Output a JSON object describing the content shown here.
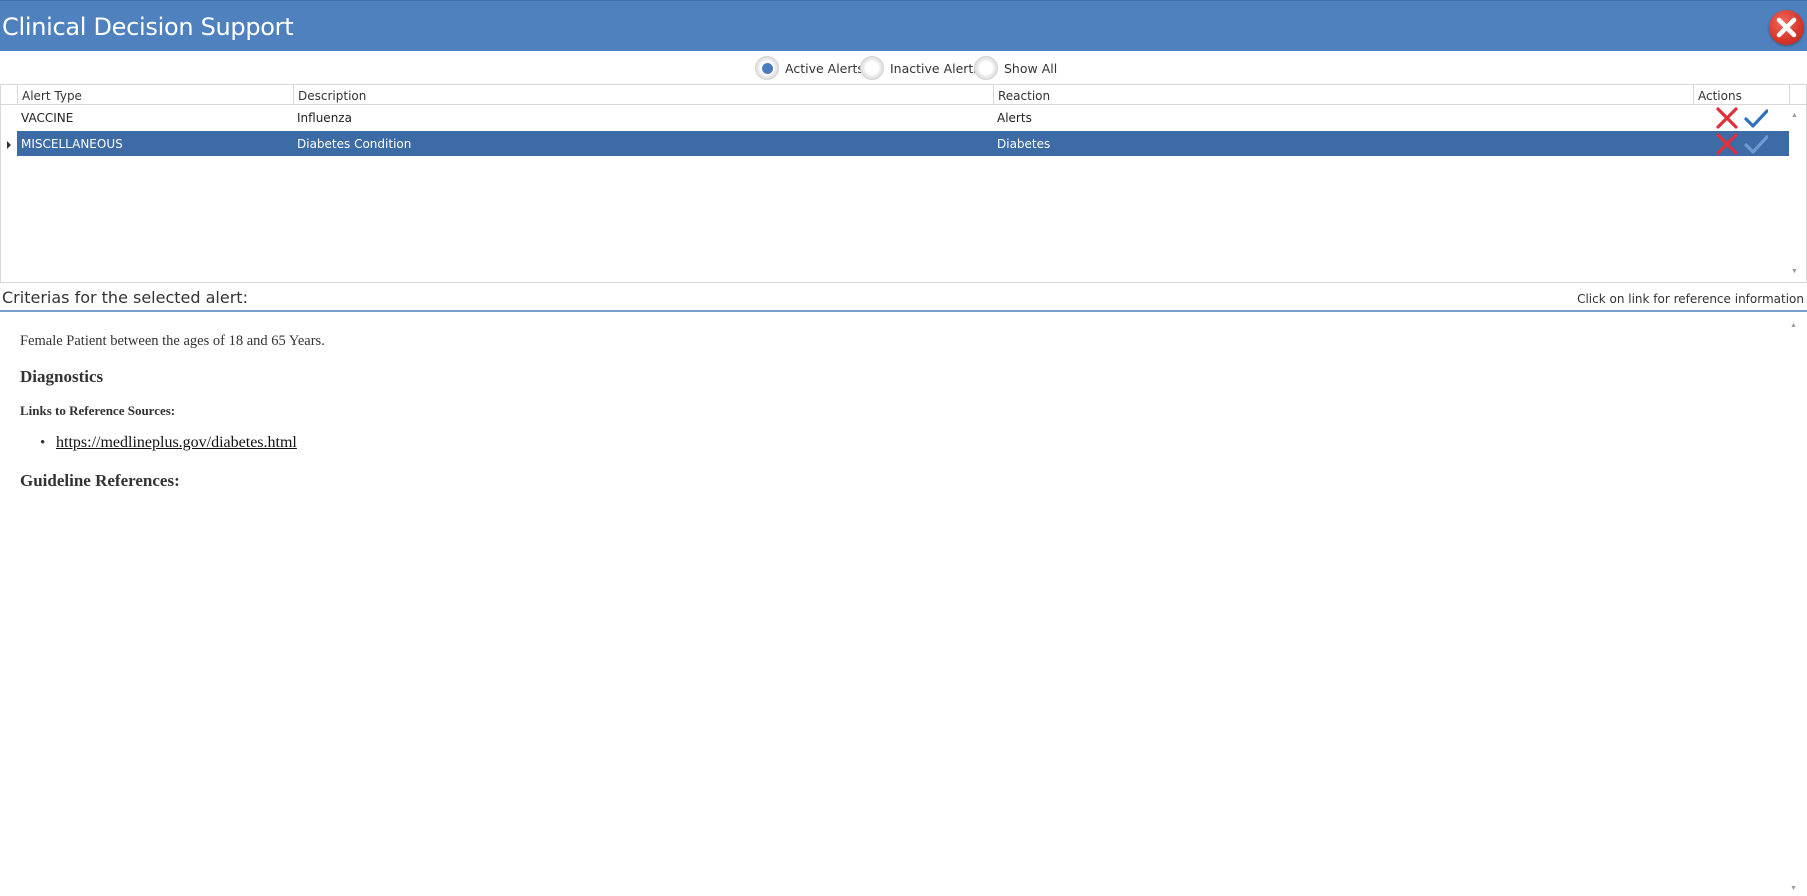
{
  "window": {
    "title": "Clinical Decision Support",
    "close_icon": "close-icon"
  },
  "filters": {
    "options": [
      "Active Alerts",
      "Inactive Alerts",
      "Show All"
    ],
    "selected": "Active Alerts"
  },
  "grid": {
    "columns": [
      "Alert Type",
      "Description",
      "Reaction",
      "Actions"
    ],
    "rows": [
      {
        "alert_type": "VACCINE",
        "description": "Influenza",
        "reaction": "Alerts",
        "selected": false
      },
      {
        "alert_type": "MISCELLANEOUS",
        "description": "Diabetes Condition",
        "reaction": "Diabetes",
        "selected": true
      }
    ],
    "action_icons": [
      "reject-icon",
      "accept-icon"
    ]
  },
  "criteria": {
    "label": "Criterias for the selected alert:",
    "hint": "Click on link for reference information"
  },
  "content": {
    "criteria_text": "Female Patient between the ages of 18 and 65 Years.",
    "diagnostics_heading": "Diagnostics",
    "links_heading": "Links to Reference Sources:",
    "links": [
      "https://medlineplus.gov/diabetes.html"
    ],
    "guideline_heading": "Guideline References:"
  },
  "colors": {
    "titlebar": "#4e81be",
    "selected_row": "#3c6ba6",
    "reject": "#e0303a",
    "accept": "#2f6fb8"
  }
}
